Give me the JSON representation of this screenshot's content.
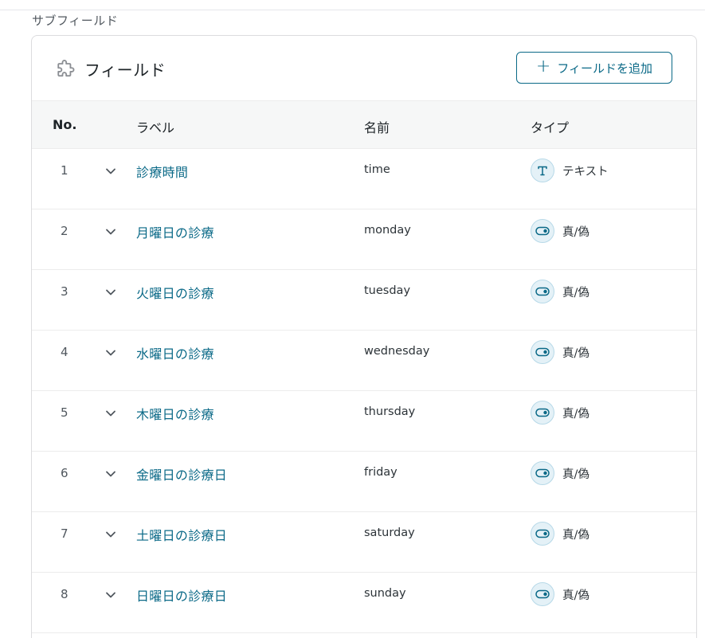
{
  "section_label": "サブフィールド",
  "panel": {
    "title": "フィールド",
    "add_button_label": "フィールドを追加"
  },
  "table": {
    "headers": {
      "no": "No.",
      "label": "ラベル",
      "name": "名前",
      "type": "タイプ"
    },
    "rows": [
      {
        "no": "1",
        "label": "診療時間",
        "name": "time",
        "type": "テキスト",
        "type_icon": "text-type-icon"
      },
      {
        "no": "2",
        "label": "月曜日の診療",
        "name": "monday",
        "type": "真/偽",
        "type_icon": "toggle-type-icon"
      },
      {
        "no": "3",
        "label": "火曜日の診療",
        "name": "tuesday",
        "type": "真/偽",
        "type_icon": "toggle-type-icon"
      },
      {
        "no": "4",
        "label": "水曜日の診療",
        "name": "wednesday",
        "type": "真/偽",
        "type_icon": "toggle-type-icon"
      },
      {
        "no": "5",
        "label": "木曜日の診療",
        "name": "thursday",
        "type": "真/偽",
        "type_icon": "toggle-type-icon"
      },
      {
        "no": "6",
        "label": "金曜日の診療日",
        "name": "friday",
        "type": "真/偽",
        "type_icon": "toggle-type-icon"
      },
      {
        "no": "7",
        "label": "土曜日の診療日",
        "name": "saturday",
        "type": "真/偽",
        "type_icon": "toggle-type-icon"
      },
      {
        "no": "8",
        "label": "日曜日の診療日",
        "name": "sunday",
        "type": "真/偽",
        "type_icon": "toggle-type-icon"
      }
    ]
  },
  "colors": {
    "accent": "#0a6987",
    "header_bg": "#f6f7f7",
    "icon_bg": "#e4f1f7"
  }
}
